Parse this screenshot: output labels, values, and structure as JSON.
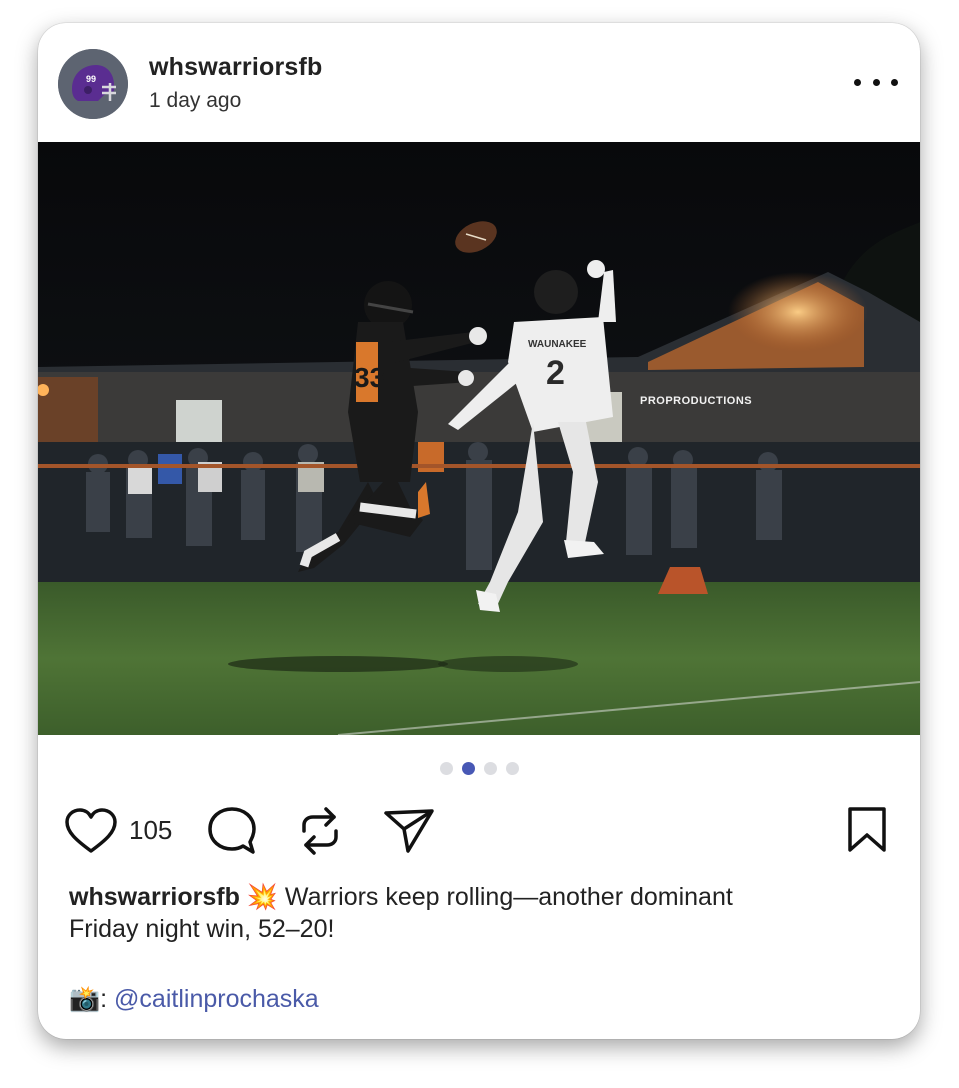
{
  "post": {
    "username": "whswarriorsfb",
    "time_ago": "1 day ago",
    "avatar": {
      "helmet_number": "99",
      "helmet_color": "#5a2d91"
    },
    "image": {
      "watermark": "PROPRODUCTIONS",
      "player_left_number": "33",
      "player_right_jersey_text": "WAUNAKEE",
      "player_right_number": "2"
    },
    "carousel": {
      "count": 4,
      "active_index": 1
    },
    "likes": "105",
    "caption": {
      "author": "whswarriorsfb",
      "emoji": "💥",
      "line1": "Warriors keep rolling—another dominant",
      "line2": "Friday night win, 52–20!"
    },
    "credit": {
      "emoji": "📸",
      "separator": ":",
      "mention": "@caitlinprochaska"
    },
    "icons": {
      "more": "more-options-icon",
      "like": "heart-icon",
      "comment": "comment-icon",
      "repost": "repost-icon",
      "share": "send-icon",
      "save": "bookmark-icon"
    },
    "colors": {
      "accent": "#4858b5",
      "mention": "#4a5aa8"
    }
  }
}
